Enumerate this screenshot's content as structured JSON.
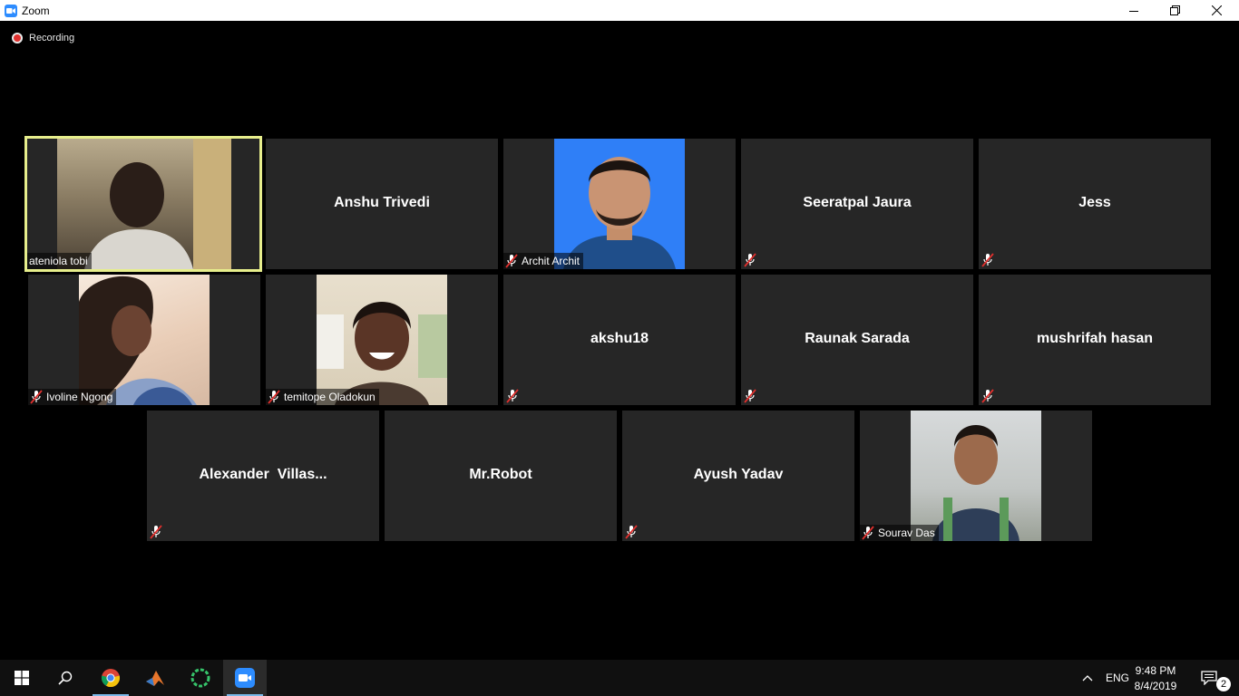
{
  "window": {
    "title": "Zoom"
  },
  "recording": {
    "label": "Recording"
  },
  "participants": [
    {
      "name": "ateniola tobi",
      "video": true,
      "muted": false,
      "active_speaker": true
    },
    {
      "name": "Anshu Trivedi",
      "video": false,
      "muted": false
    },
    {
      "name": "Archit Archit",
      "video": true,
      "muted": true
    },
    {
      "name": "Seeratpal Jaura",
      "video": false,
      "muted": true
    },
    {
      "name": "Jess",
      "video": false,
      "muted": true
    },
    {
      "name": "Ivoline Ngong",
      "video": true,
      "muted": true
    },
    {
      "name": "temitope Oladokun",
      "video": true,
      "muted": true
    },
    {
      "name": "akshu18",
      "video": false,
      "muted": true
    },
    {
      "name": "Raunak Sarada",
      "video": false,
      "muted": true
    },
    {
      "name": "mushrifah hasan",
      "video": false,
      "muted": true
    },
    {
      "name": "Alexander  Villas...",
      "video": false,
      "muted": true
    },
    {
      "name": "Mr.Robot",
      "video": false,
      "muted": false
    },
    {
      "name": "Ayush Yadav",
      "video": false,
      "muted": true
    },
    {
      "name": "Sourav Das",
      "video": true,
      "muted": true
    }
  ],
  "taskbar": {
    "apps": [
      "start-icon",
      "search-icon",
      "chrome-icon",
      "matlab-icon",
      "circle-app-icon",
      "zoom-icon"
    ],
    "language": "ENG",
    "time": "9:48 PM",
    "date": "8/4/2019",
    "notification_count": "2"
  },
  "colors": {
    "active_speaker_border": "#e7ee8c",
    "tile_bg": "#262626",
    "zoom_blue": "#2d8cff",
    "muted_red": "#e0302e"
  }
}
